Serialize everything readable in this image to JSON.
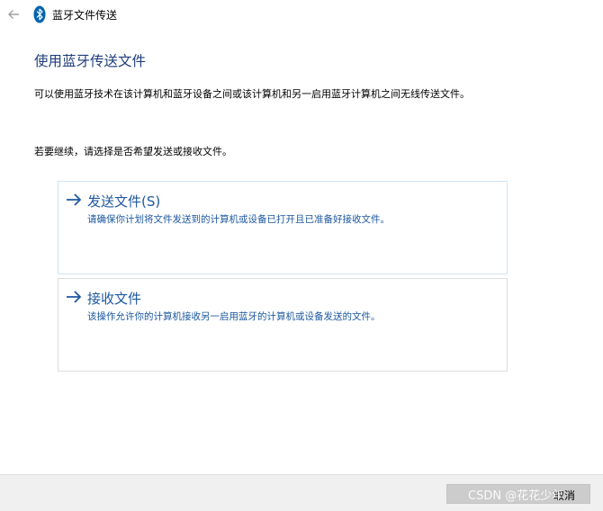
{
  "window": {
    "title": "蓝牙文件传送",
    "back_icon": "arrow-left-icon",
    "app_icon": "bluetooth-icon"
  },
  "main": {
    "heading": "使用蓝牙传送文件",
    "description": "可以使用蓝牙技术在该计算机和蓝牙设备之间或该计算机和另一启用蓝牙计算机之间无线传送文件。",
    "prompt": "若要继续，请选择是否希望发送或接收文件。"
  },
  "options": [
    {
      "title": "发送文件(S)",
      "description": "请确保你计划将文件发送到的计算机或设备已打开且已准备好接收文件。",
      "icon": "arrow-right-icon"
    },
    {
      "title": "接收文件",
      "description": "该操作允许你的计算机接收另一启用蓝牙的计算机或设备发送的文件。",
      "icon": "arrow-right-icon"
    }
  ],
  "footer": {
    "cancel_label": "取消",
    "watermark": "CSDN @花花少年"
  },
  "colors": {
    "accent": "#1e58a0",
    "heading": "#1f3d7a",
    "footer_bg": "#f0f0f0",
    "bluetooth": "#0063b1"
  }
}
